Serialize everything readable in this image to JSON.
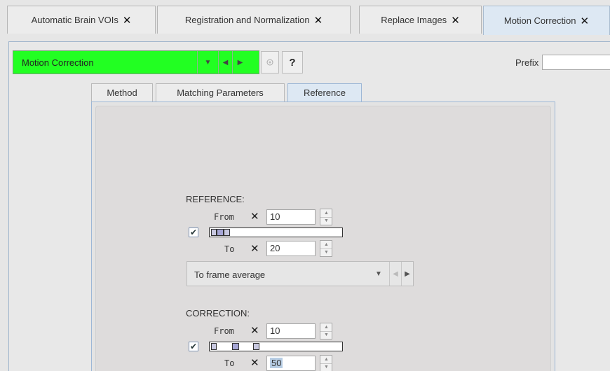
{
  "tabs": [
    {
      "label": "Automatic Brain VOIs",
      "close": "✕"
    },
    {
      "label": "Registration and Normalization",
      "close": "✕"
    },
    {
      "label": "Replace Images",
      "close": "✕"
    },
    {
      "label": "Motion Correction",
      "close": "✕",
      "active": true
    }
  ],
  "toolbar": {
    "selector_value": "Motion Correction",
    "help_label": "?",
    "prefix_label": "Prefix",
    "prefix_value": ""
  },
  "subtabs": [
    "Method",
    "Matching Parameters",
    "Reference"
  ],
  "reference": {
    "heading": "REFERENCE:",
    "from_label": "From",
    "from_value": "10",
    "to_label": "To",
    "to_value": "20",
    "enabled": true,
    "mode_value": "To frame average"
  },
  "correction": {
    "heading": "CORRECTION:",
    "from_label": "From",
    "from_value": "10",
    "to_label": "To",
    "to_value": "50",
    "enabled": true
  },
  "colors": {
    "selector_bg": "#22ff22",
    "active_tab_bg": "#dde8f3"
  }
}
